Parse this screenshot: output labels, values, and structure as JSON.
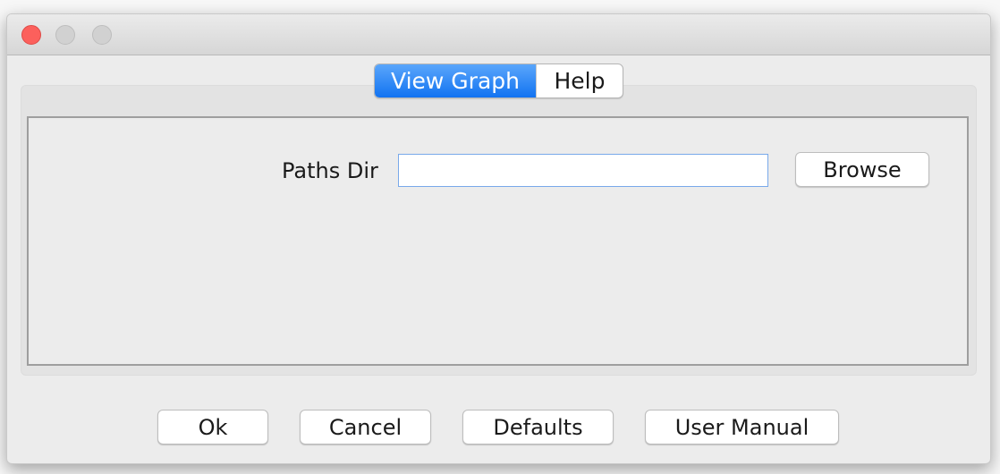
{
  "window": {
    "controls": {
      "close": "close-button",
      "minimize": "minimize-button",
      "zoom": "zoom-button"
    },
    "colors": {
      "close": "#fc605c",
      "inactive_control": "#d1d1d1",
      "active_tab": "#1273f1"
    }
  },
  "tabs": [
    {
      "label": "View Graph",
      "active": true
    },
    {
      "label": "Help",
      "active": false
    }
  ],
  "form": {
    "paths_dir_label": "Paths Dir",
    "paths_dir_value": "",
    "browse_label": "Browse"
  },
  "buttons": {
    "ok": "Ok",
    "cancel": "Cancel",
    "defaults": "Defaults",
    "user_manual": "User Manual"
  }
}
